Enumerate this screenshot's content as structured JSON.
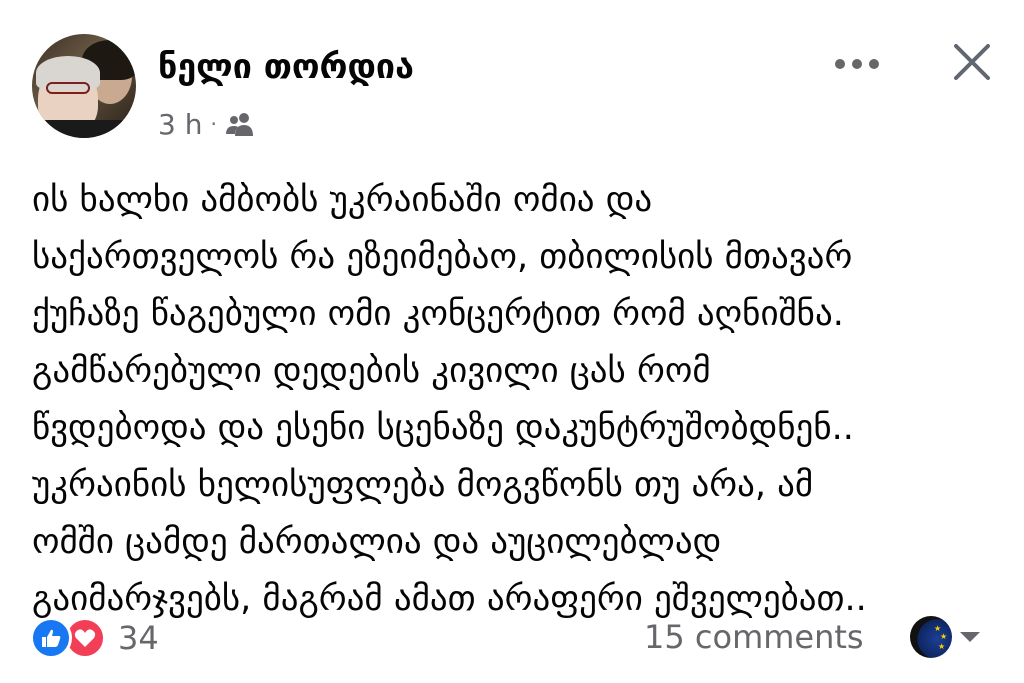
{
  "author": {
    "name": "ნელი თორდია",
    "time": "3 h",
    "separator": "·",
    "audience_icon": "friends-icon"
  },
  "post": {
    "lines": [
      "ის ხალხი ამბობს უკრაინაში ომია და",
      "საქართველოს რა ეზეიმებაო, თბილისის მთავარ",
      "ქუჩაზე წაგებული ომი კონცერტით რომ აღნიშნა.",
      "გამწარებული დედების კივილი ცას რომ",
      "წვდებოდა და ესენი სცენაზე დაკუნტრუშობდნენ..",
      "უკრაინის ხელისუფლება მოგვწონს თუ არა, ამ",
      "ომში ცამდე მართალია და აუცილებლად",
      "გაიმარჯვებს, მაგრამ ამათ არაფერი ეშველებათ.."
    ]
  },
  "footer": {
    "reaction_count": "34",
    "comments": "15 comments"
  },
  "colors": {
    "like": "#1877f2",
    "love": "#f33e58",
    "secondary_text": "#65676b"
  }
}
